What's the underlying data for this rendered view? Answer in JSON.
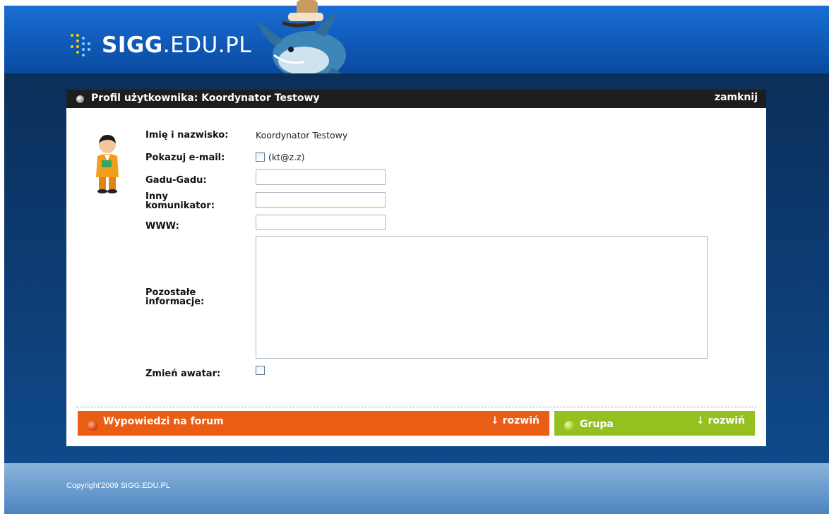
{
  "site": {
    "logo_bold": "SIGG",
    "logo_rest": ".EDU.PL"
  },
  "panel": {
    "title": "Profil użytkownika: Koordynator Testowy",
    "close_label": "zamknij"
  },
  "form": {
    "name_label": "Imię i nazwisko:",
    "name_value": "Koordynator Testowy",
    "show_email_label": "Pokazuj e-mail:",
    "email_value": "(kt@z.z)",
    "gg_label": "Gadu-Gadu:",
    "gg_value": "",
    "other_label_1": "Inny",
    "other_label_2": "komunikator:",
    "other_value": "",
    "www_label": "WWW:",
    "www_value": "",
    "info_label_1": "Pozostałe",
    "info_label_2": "informacje:",
    "info_value": "",
    "avatar_label": "Zmień awatar:"
  },
  "bars": {
    "forum_title": "Wypowiedzi na forum",
    "forum_expand": "↓ rozwiń",
    "group_title": "Grupa",
    "group_expand": "↓ rozwiń"
  },
  "colors": {
    "header": "#1565c8",
    "forum_bar": "#e95d14",
    "group_bar": "#94c11f",
    "panel_head": "#1e1e1e"
  },
  "footer": {
    "copyright": "Copyright'2009 SIGG.EDU.PL"
  }
}
